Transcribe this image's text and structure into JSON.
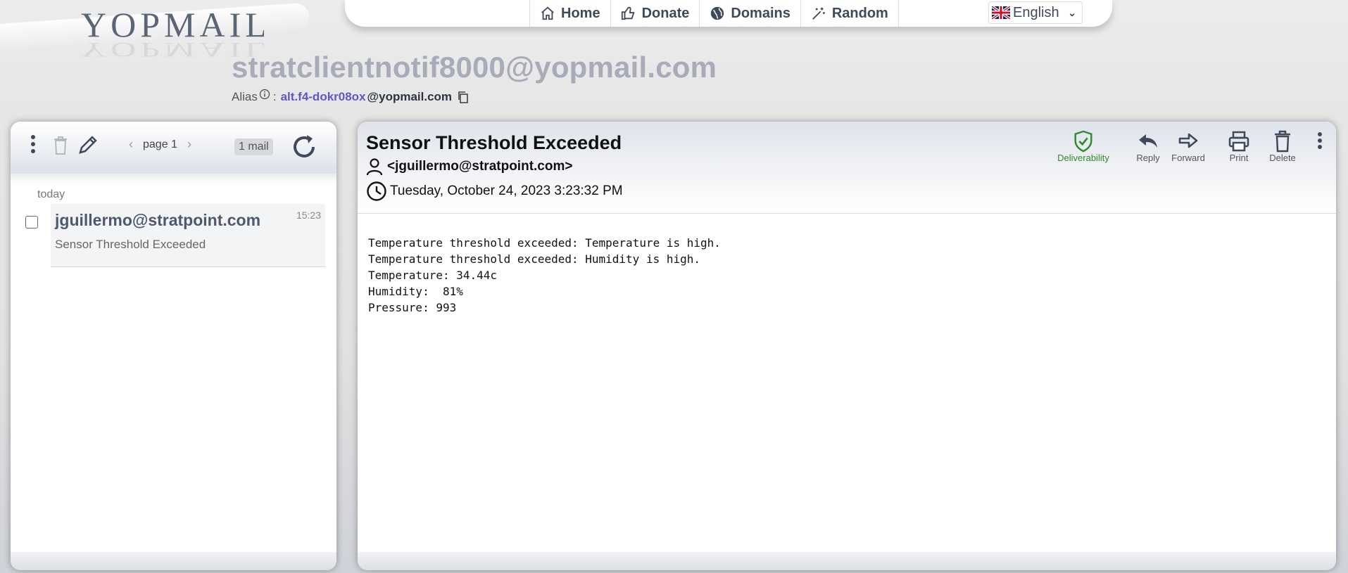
{
  "logo": {
    "text": "YOPMAIL"
  },
  "nav": {
    "items": [
      {
        "label": "Home",
        "icon": "home-icon"
      },
      {
        "label": "Donate",
        "icon": "thumbs-up-icon"
      },
      {
        "label": "Domains",
        "icon": "globe-icon"
      },
      {
        "label": "Random",
        "icon": "magic-wand-icon"
      }
    ],
    "language": "English"
  },
  "inbox": {
    "email": "stratclientnotif8000@yopmail.com",
    "alias_label": "Alias",
    "alias_separator": ":",
    "alias_name": "alt.f4-dokr08ox",
    "alias_domain": "@yopmail.com"
  },
  "list": {
    "page_label": "page 1",
    "count_label": "1 mail",
    "day_label": "today",
    "items": [
      {
        "from": "jguillermo@stratpoint.com",
        "subject": "Sensor Threshold Exceeded",
        "time": "15:23"
      }
    ]
  },
  "message": {
    "subject": "Sensor Threshold Exceeded",
    "from": "<jguillermo@stratpoint.com>",
    "date": "Tuesday, October 24, 2023 3:23:32 PM",
    "actions": {
      "deliverability": "Deliverability",
      "reply": "Reply",
      "forward": "Forward",
      "print": "Print",
      "delete": "Delete"
    },
    "body": "Temperature threshold exceeded: Temperature is high.\nTemperature threshold exceeded: Humidity is high.\nTemperature: 34.44c\nHumidity:  81%\nPressure: 993"
  },
  "colors": {
    "accent": "#5b59c7",
    "deliverability": "#2e8b2e",
    "nav_text": "#3e4a5c"
  }
}
